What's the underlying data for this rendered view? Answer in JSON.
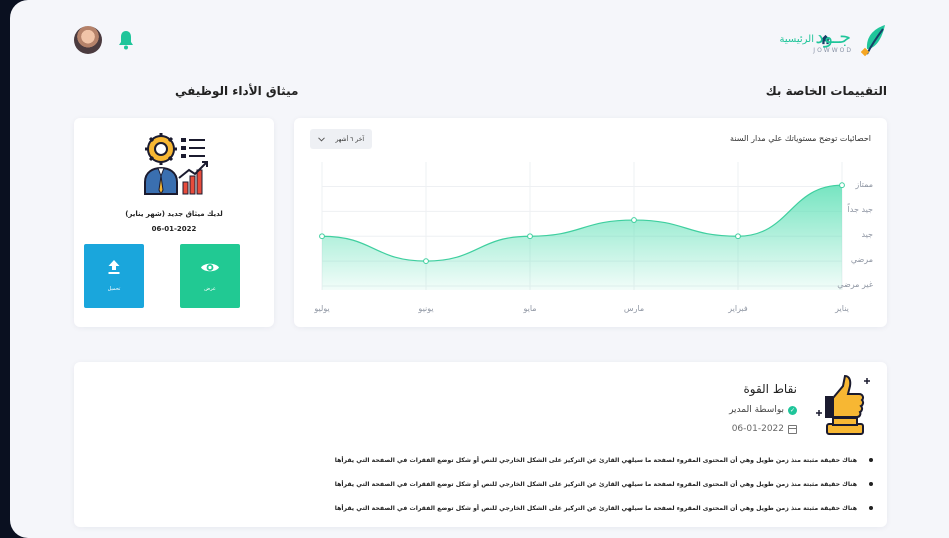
{
  "brand": {
    "name_ar": "جـود",
    "name_en": "JOWWOD",
    "accent": "#1fc59a"
  },
  "nav": {
    "home_label": "الرئيسية"
  },
  "sections": {
    "evaluations_title": "التقييمات الخاصة بك",
    "charter_title": "ميثاق الأداء الوظيفي"
  },
  "chart": {
    "title": "احصائيات توضح مستوياتك علي مدار السنة",
    "period_select": "آخر ٦ أشهر"
  },
  "chart_data": {
    "type": "area",
    "title": "احصائيات توضح مستوياتك علي مدار السنة",
    "y_levels": [
      "غير مرضي",
      "مرضي",
      "جيد",
      "جيد جداً",
      "ممتاز"
    ],
    "categories": [
      "يناير",
      "فبراير",
      "مارس",
      "مايو",
      "يونيو",
      "يوليو"
    ],
    "values": [
      4.05,
      2.0,
      2.65,
      2.0,
      1.0,
      2.0
    ],
    "ylim": [
      0,
      4.5
    ],
    "grid": true,
    "color": "#5ee0b6"
  },
  "charter": {
    "text": "لديك ميثاق جديد (شهر يناير)",
    "date": "06-01-2022",
    "upload_label": "تحميل",
    "view_label": "عرض"
  },
  "strengths": {
    "title": "نقاط القوة",
    "by": "بواسطة المدير",
    "date": "06-01-2022",
    "items": [
      "هناك حقيقة مثبتة منذ زمن طويل وهي أن المحتوى المقروء لصفحة ما سيلهي القارئ عن التركيز على الشكل الخارجي للنص أو شكل توضع الفقرات في الصفحة التي يقرأها",
      "هناك حقيقة مثبتة منذ زمن طويل وهي أن المحتوى المقروء لصفحة ما سيلهي القارئ عن التركيز على الشكل الخارجي للنص أو شكل توضع الفقرات في الصفحة التي يقرأها",
      "هناك حقيقة مثبتة منذ زمن طويل وهي أن المحتوى المقروء لصفحة ما سيلهي القارئ عن التركيز على الشكل الخارجي للنص أو شكل توضع الفقرات في الصفحة التي يقرأها"
    ]
  }
}
